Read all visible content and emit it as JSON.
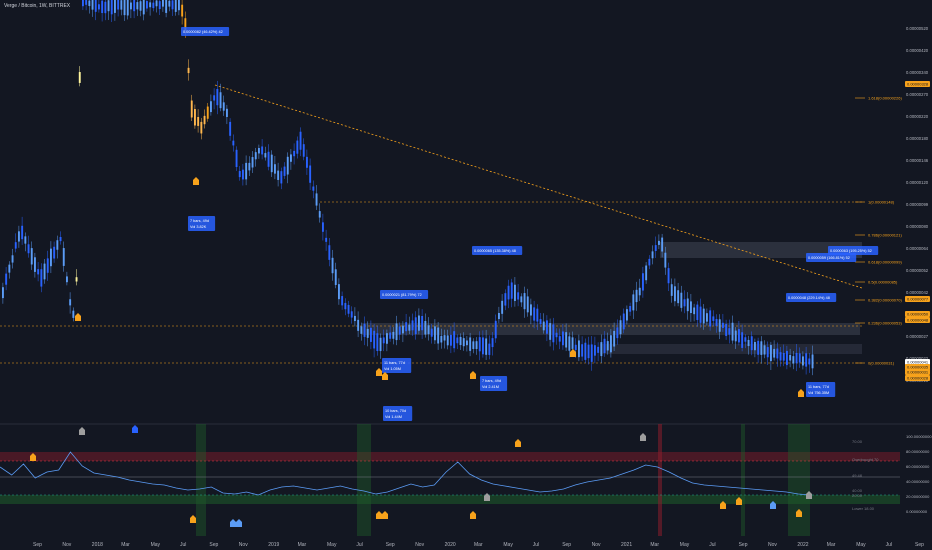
{
  "chart_data": [
    {
      "type": "candlestick",
      "title": "Verge / Bitcoin, 1W, BITTREX",
      "ylabel": "",
      "xlabel": "",
      "log_scale": true,
      "ylim": [
        3e-07,
        1.4e-05
      ],
      "x_ticks": [
        "Sep",
        "Nov",
        "2018",
        "Mar",
        "May",
        "Jul",
        "Sep",
        "Nov",
        "2019",
        "Mar",
        "May",
        "Jul",
        "Sep",
        "Nov",
        "2020",
        "Mar",
        "May",
        "Jul",
        "Sep",
        "Nov",
        "2021",
        "Mar",
        "May",
        "Jul",
        "Sep",
        "Nov",
        "2022",
        "Mar",
        "May",
        "Jul",
        "Sep"
      ],
      "y_ticks": [
        "0.00000520",
        "0.00000420",
        "0.00000340",
        "0.00000270",
        "0.00000220",
        "0.00000180",
        "0.00000146",
        "0.00000120",
        "0.00000099",
        "0.00000080",
        "0.00000064",
        "0.00000052",
        "0.00000042",
        "0.00000034",
        "0.00000027",
        "0.00000022",
        "0.00000018"
      ],
      "price_badges": [
        {
          "text": "0.00000328",
          "color": "#f7a21b"
        },
        {
          "text": "0.00000077",
          "color": "#f7a21b"
        },
        {
          "text": "0.00000050",
          "color": "#f7a21b"
        },
        {
          "text": "0.00000048",
          "color": "#f7a21b"
        },
        {
          "text": "0.00000041",
          "color": "#ffffff"
        },
        {
          "text": "0.00000035",
          "color": "#f7a21b"
        },
        {
          "text": "0.00000031",
          "color": "#f7a21b"
        },
        {
          "text": "0.00000028",
          "color": "#f7a21b"
        }
      ],
      "fib_levels": [
        {
          "label": "1.618(0.00000226)"
        },
        {
          "label": "1(0.00000148)"
        },
        {
          "label": "0.786(0.00000121)"
        },
        {
          "label": "0.618(0.00000099)"
        },
        {
          "label": "0.5(0.00000085)"
        },
        {
          "label": "0.382(0.00000070)"
        },
        {
          "label": "0.236(0.00000053)"
        },
        {
          "label": "0(0.00000031)"
        }
      ],
      "annotations": [
        {
          "text": "0.0000082 (46.42%) 42"
        },
        {
          "text": "7 bars, 49d\nVol 3.82K"
        },
        {
          "text": "0.0000021 (81.79%) 72"
        },
        {
          "text": "11 bars, 77d\nVol 1.05M"
        },
        {
          "text": "10 bars, 70d\nVol 1.44M"
        },
        {
          "text": "0.0000065 (135.38%) 48"
        },
        {
          "text": "7 bars, 49d\nVol 2.41M"
        },
        {
          "text": "0.0000048 (229.14%) 48"
        },
        {
          "text": "0.0000059 (166.81%) 52"
        },
        {
          "text": "0.0000063 (195.25%) 52"
        },
        {
          "text": "11 bars, 77d\nVol 756.35M"
        }
      ],
      "key_points": [
        {
          "date": "2018-01",
          "price": 5.5e-06
        },
        {
          "date": "2018-07",
          "price": 3.8e-06
        },
        {
          "date": "2018-09",
          "price": 3e-06
        },
        {
          "date": "2019-06",
          "price": 1.6e-06
        },
        {
          "date": "2019-08",
          "price": 4.7e-07
        },
        {
          "date": "2020-02",
          "price": 8.2e-07
        },
        {
          "date": "2020-03",
          "price": 3.5e-07
        },
        {
          "date": "2020-07",
          "price": 8.5e-07
        },
        {
          "date": "2020-12",
          "price": 3.3e-07
        },
        {
          "date": "2021-05",
          "price": 1.7e-06
        },
        {
          "date": "2021-07",
          "price": 6e-07
        },
        {
          "date": "2021-09",
          "price": 7.5e-07
        },
        {
          "date": "2022-02",
          "price": 4e-07
        },
        {
          "date": "2022-04",
          "price": 2.9e-07
        }
      ]
    },
    {
      "type": "line",
      "title": "",
      "y_ticks": [
        "100.00000000",
        "80.00000000",
        "60.00000000",
        "40.00000000",
        "20.00000000",
        "0.00000000"
      ],
      "ylim": [
        0,
        100
      ],
      "level_labels": [
        "70.00",
        "Overbought 70",
        "49.48",
        "40.00",
        "20.00",
        "Lower 18.00"
      ],
      "series": [
        {
          "values": [
            63,
            55,
            66,
            52,
            58,
            60,
            78,
            64,
            57,
            55,
            53,
            50,
            48,
            46,
            45,
            42,
            40,
            41,
            43,
            37,
            36,
            38,
            35,
            40,
            43,
            44,
            42,
            40,
            42,
            44,
            41,
            39,
            36,
            38,
            42,
            46,
            43,
            45,
            58,
            68,
            56,
            50,
            46,
            44,
            42,
            40,
            38,
            39,
            41,
            45,
            48,
            50,
            52,
            56,
            60,
            65,
            63,
            58,
            52,
            47,
            45,
            44,
            43,
            42,
            41,
            40,
            39,
            38,
            36,
            35
          ]
        }
      ]
    }
  ]
}
